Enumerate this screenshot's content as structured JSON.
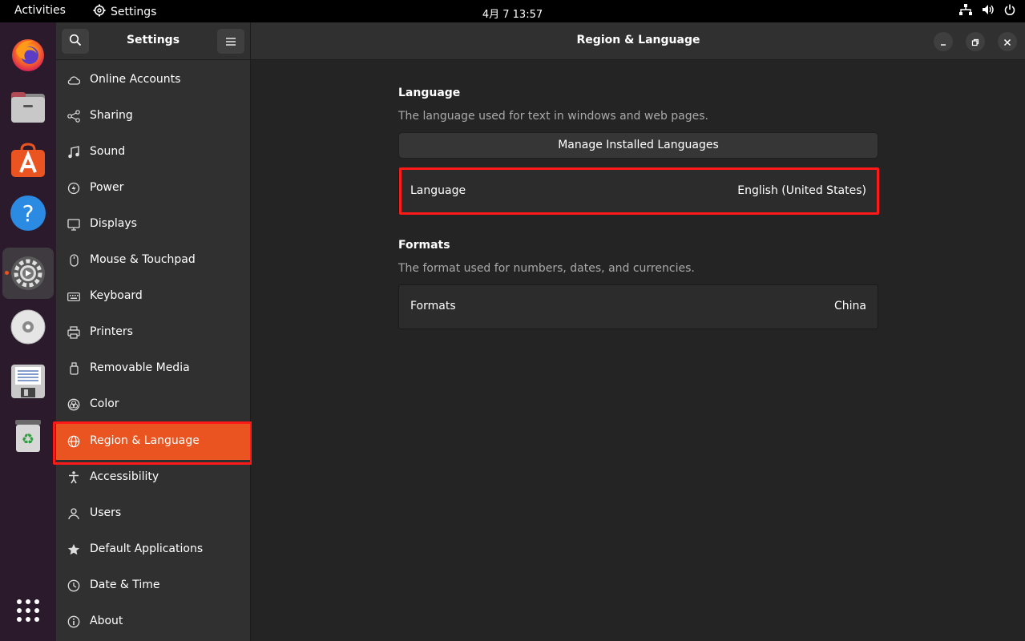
{
  "topbar": {
    "activities": "Activities",
    "app_name": "Settings",
    "clock": "4月 7  13:57"
  },
  "dock": {
    "items": [
      "firefox-icon",
      "files-icon",
      "app-center-icon",
      "help-icon",
      "settings-icon",
      "disc-icon",
      "save-icon",
      "trash-icon",
      "show-apps-icon"
    ]
  },
  "header": {
    "settings_title": "Settings",
    "page_title": "Region & Language"
  },
  "sidebar": {
    "items": [
      {
        "label": "Online Accounts",
        "icon": "cloud-icon"
      },
      {
        "label": "Sharing",
        "icon": "share-icon"
      },
      {
        "label": "Sound",
        "icon": "music-note-icon"
      },
      {
        "label": "Power",
        "icon": "power-icon"
      },
      {
        "label": "Displays",
        "icon": "display-icon"
      },
      {
        "label": "Mouse & Touchpad",
        "icon": "mouse-icon"
      },
      {
        "label": "Keyboard",
        "icon": "keyboard-icon"
      },
      {
        "label": "Printers",
        "icon": "printer-icon"
      },
      {
        "label": "Removable Media",
        "icon": "usb-drive-icon"
      },
      {
        "label": "Color",
        "icon": "color-icon"
      },
      {
        "label": "Region & Language",
        "icon": "globe-icon",
        "selected": true
      },
      {
        "label": "Accessibility",
        "icon": "accessibility-icon"
      },
      {
        "label": "Users",
        "icon": "users-icon"
      },
      {
        "label": "Default Applications",
        "icon": "star-icon"
      },
      {
        "label": "Date & Time",
        "icon": "clock-icon"
      },
      {
        "label": "About",
        "icon": "info-icon"
      }
    ]
  },
  "content": {
    "language_section": {
      "title": "Language",
      "description": "The language used for text in windows and web pages.",
      "manage_button": "Manage Installed Languages",
      "row_label": "Language",
      "row_value": "English (United States)"
    },
    "formats_section": {
      "title": "Formats",
      "description": "The format used for numbers, dates, and currencies.",
      "row_label": "Formats",
      "row_value": "China"
    }
  },
  "colors": {
    "accent": "#e95420",
    "highlight": "#ff1a1a"
  }
}
